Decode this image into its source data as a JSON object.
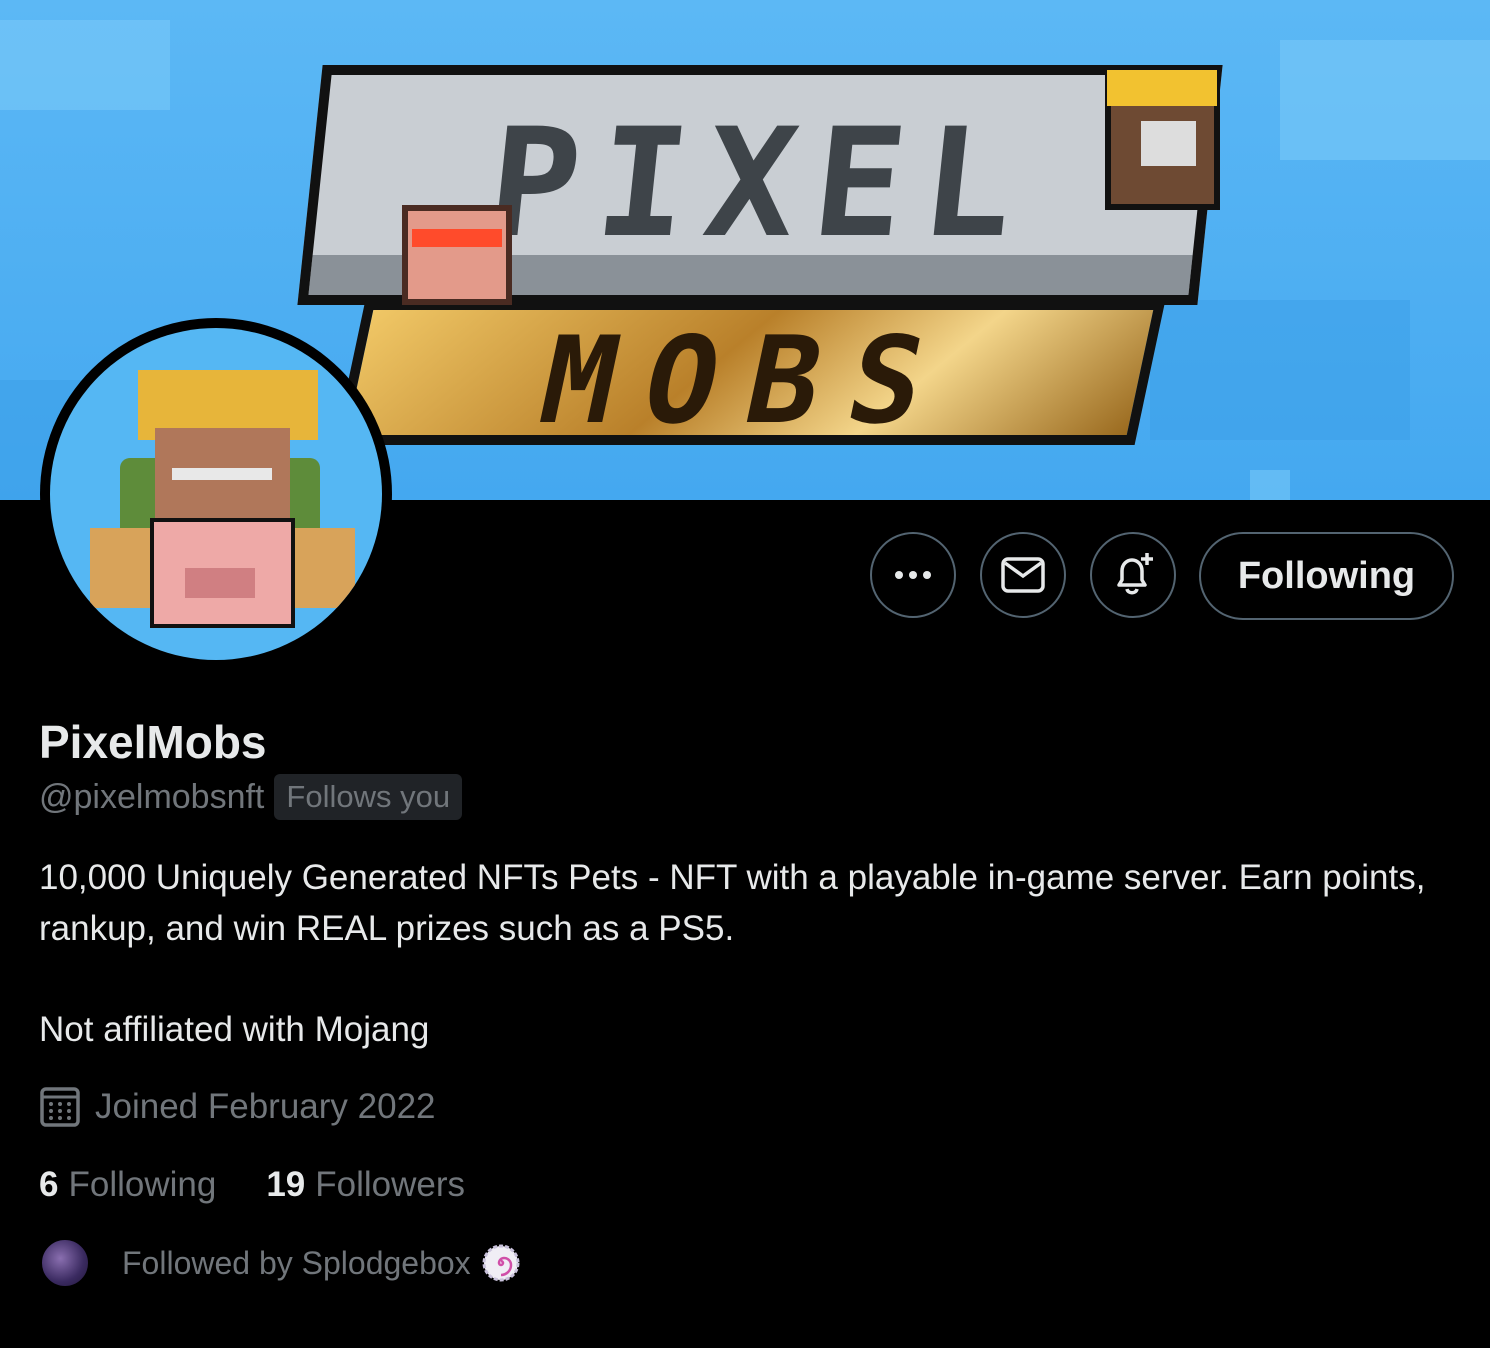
{
  "banner": {
    "logo_top": "PIXEL",
    "logo_bottom": "MOBS"
  },
  "actions": {
    "more_icon": "more-horizontal-icon",
    "message_icon": "envelope-icon",
    "notify_icon": "bell-plus-icon",
    "follow_label": "Following"
  },
  "profile": {
    "name": "PixelMobs",
    "handle": "@pixelmobsnft",
    "follows_you": "Follows you",
    "bio_line1": "10,000 Uniquely Generated NFTs Pets - NFT with a playable in-game server. Earn points, rankup, and win REAL prizes such as a PS5.",
    "bio_line2": "Not affiliated with Mojang",
    "joined_icon": "calendar-icon",
    "joined": "Joined February 2022"
  },
  "stats": {
    "following_count": "6",
    "following_label": "Following",
    "followers_count": "19",
    "followers_label": "Followers"
  },
  "followed_by": {
    "text": "Followed by Splodgebox",
    "badge_icon": "spiral-badge-icon"
  },
  "colors": {
    "background": "#000000",
    "banner": "#4cafef",
    "muted": "#71767b",
    "text": "#e7e9ea",
    "border": "#536471"
  }
}
